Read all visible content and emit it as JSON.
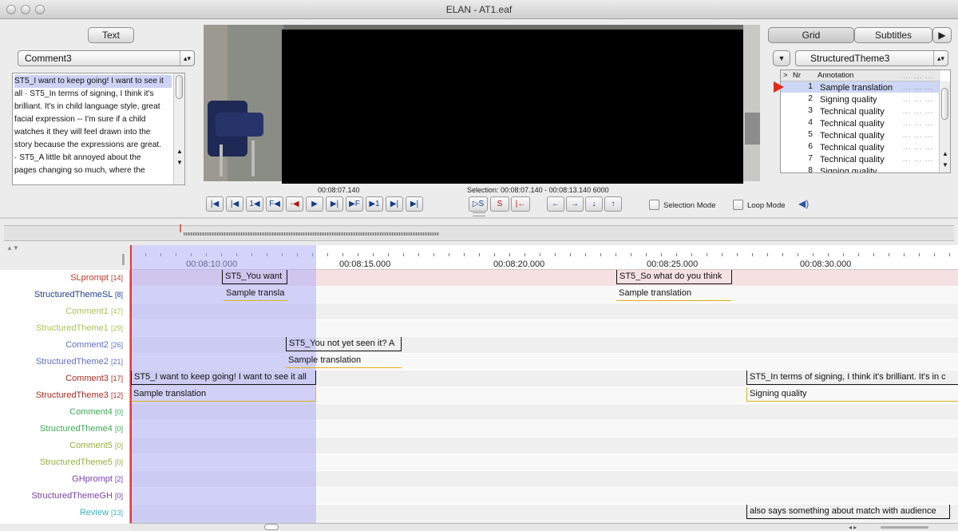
{
  "window": {
    "title": "ELAN - AT1.eaf"
  },
  "left_panel": {
    "tab": "Text",
    "combo": "Comment3",
    "lines": [
      {
        "text": "ST5_I want to keep going! I want to see it",
        "hl": true
      },
      {
        "text": "all  ·  ST5_In terms of signing, I think it's",
        "hl": false
      },
      {
        "text": "brilliant. It's in child language style, great",
        "hl": false
      },
      {
        "text": "facial expression -- I'm sure if a child",
        "hl": false
      },
      {
        "text": "watches it they will feel drawn into the",
        "hl": false
      },
      {
        "text": "story because the expressions are great.",
        "hl": false
      },
      {
        "text": "  ·  ST5_A little bit annoyed about the",
        "hl": false
      },
      {
        "text": "pages changing so much, where the",
        "hl": false
      }
    ]
  },
  "media": {
    "time": "00:08:07.140",
    "selection": "Selection: 00:08:07.140 - 00:08:13.140  6000"
  },
  "transport": {
    "buttons": [
      "|◀",
      "|◀",
      "1◀",
      "F◀",
      "-◀",
      "▶",
      "▶|",
      "▶F",
      "▶1",
      "▶|",
      "▶|"
    ],
    "sel_buttons": [
      "▷S",
      "S",
      "|←"
    ],
    "arrows": [
      "←",
      "→",
      "↓",
      "↑"
    ],
    "selection_mode": "Selection Mode",
    "loop_mode": "Loop Mode",
    "volume_icon": "speaker-icon"
  },
  "right_panel": {
    "tabs": [
      "Grid",
      "Subtitles"
    ],
    "combo": "StructuredTheme3",
    "headers": {
      "expand": ">",
      "nr": "Nr",
      "annotation": "Annotation"
    },
    "rows": [
      {
        "nr": "1",
        "text": "Sample translation",
        "active": true
      },
      {
        "nr": "2",
        "text": "Signing quality",
        "active": false
      },
      {
        "nr": "3",
        "text": "Technical quality",
        "active": false
      },
      {
        "nr": "4",
        "text": "Technical quality",
        "active": false
      },
      {
        "nr": "5",
        "text": "Technical quality",
        "active": false
      },
      {
        "nr": "6",
        "text": "Technical quality",
        "active": false
      },
      {
        "nr": "7",
        "text": "Technical quality",
        "active": false
      },
      {
        "nr": "8",
        "text": "Signing quality",
        "active": false
      }
    ]
  },
  "timeline": {
    "ruler": [
      "00:08:10.000",
      "00:08:15.000",
      "00:08:20.000",
      "00:08:25.000",
      "00:08:30.000"
    ],
    "tiers": [
      {
        "name": "SLprompt",
        "count": "[14]",
        "color": "#c0392b"
      },
      {
        "name": "StructuredThemeSL",
        "count": "[8]",
        "color": "#1f3f8f"
      },
      {
        "name": "Comment1",
        "count": "[47]",
        "color": "#a9c25a"
      },
      {
        "name": "StructuredTheme1",
        "count": "[29]",
        "color": "#a9c25a"
      },
      {
        "name": "Comment2",
        "count": "[26]",
        "color": "#5c6fc9"
      },
      {
        "name": "StructuredTheme2",
        "count": "[21]",
        "color": "#5c6fc9"
      },
      {
        "name": "Comment3",
        "count": "[17]",
        "color": "#b02a20"
      },
      {
        "name": "StructuredTheme3",
        "count": "[12]",
        "color": "#b02a20"
      },
      {
        "name": "Comment4",
        "count": "[0]",
        "color": "#3cab55"
      },
      {
        "name": "StructuredTheme4",
        "count": "[0]",
        "color": "#3cab55"
      },
      {
        "name": "Comment5",
        "count": "[0]",
        "color": "#94b040"
      },
      {
        "name": "StructuredTheme5",
        "count": "[0]",
        "color": "#94b040"
      },
      {
        "name": "GHprompt",
        "count": "[2]",
        "color": "#7a3fb0"
      },
      {
        "name": "StructuredThemeGH",
        "count": "[0]",
        "color": "#7a3fb0"
      },
      {
        "name": "Review",
        "count": "[13]",
        "color": "#3ab0bf"
      }
    ],
    "annotations": {
      "a1": "ST5_You want",
      "a2": "ST5_So what do you think",
      "a3": "Sample transla",
      "a4": "Sample translation",
      "a5": "ST5_You not yet seen it? A",
      "a6": "Sample translation",
      "a7": "ST5_I want to keep going! I want to see it all",
      "a8": "ST5_In terms of signing, I think it's brilliant. It's in c",
      "a9": "Sample translation",
      "a10": "Signing quality",
      "a11": "also says something about match with audience"
    }
  }
}
